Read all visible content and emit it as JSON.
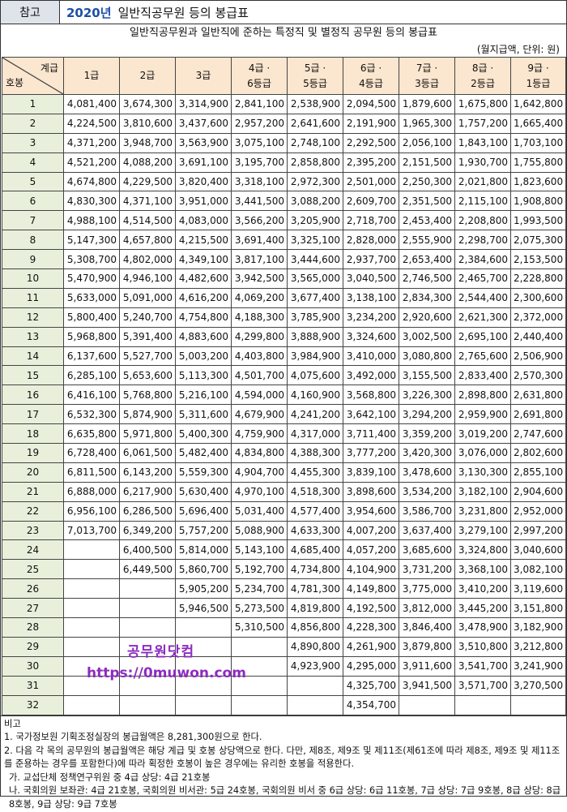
{
  "header": {
    "ref_label": "참고",
    "year": "2020년",
    "title": "일반직공무원 등의 봉급표"
  },
  "subtitle": "일반직공무원과 일반직에 준하는 특정직 및 별정직 공무원 등의 봉급표",
  "unit_note": "(월지급액, 단위: 원)",
  "table": {
    "corner_top": "계급",
    "corner_bottom": "호봉",
    "columns": [
      [
        "1급"
      ],
      [
        "2급"
      ],
      [
        "3급"
      ],
      [
        "4급 ·",
        "6등급"
      ],
      [
        "5급 ·",
        "5등급"
      ],
      [
        "6급 ·",
        "4등급"
      ],
      [
        "7급 ·",
        "3등급"
      ],
      [
        "8급 ·",
        "2등급"
      ],
      [
        "9급 ·",
        "1등급"
      ]
    ],
    "rows": [
      [
        "1",
        "4,081,400",
        "3,674,300",
        "3,314,900",
        "2,841,100",
        "2,538,900",
        "2,094,500",
        "1,879,600",
        "1,675,800",
        "1,642,800"
      ],
      [
        "2",
        "4,224,500",
        "3,810,600",
        "3,437,600",
        "2,957,200",
        "2,641,600",
        "2,191,900",
        "1,965,300",
        "1,757,200",
        "1,665,400"
      ],
      [
        "3",
        "4,371,200",
        "3,948,700",
        "3,563,900",
        "3,075,100",
        "2,748,100",
        "2,292,500",
        "2,056,100",
        "1,843,100",
        "1,703,100"
      ],
      [
        "4",
        "4,521,200",
        "4,088,200",
        "3,691,100",
        "3,195,700",
        "2,858,800",
        "2,395,200",
        "2,151,500",
        "1,930,700",
        "1,755,800"
      ],
      [
        "5",
        "4,674,800",
        "4,229,500",
        "3,820,400",
        "3,318,100",
        "2,972,300",
        "2,501,000",
        "2,250,300",
        "2,021,800",
        "1,823,600"
      ],
      [
        "6",
        "4,830,300",
        "4,371,100",
        "3,951,000",
        "3,441,500",
        "3,088,200",
        "2,609,700",
        "2,351,500",
        "2,115,100",
        "1,908,800"
      ],
      [
        "7",
        "4,988,100",
        "4,514,500",
        "4,083,000",
        "3,566,200",
        "3,205,900",
        "2,718,700",
        "2,453,400",
        "2,208,800",
        "1,993,500"
      ],
      [
        "8",
        "5,147,300",
        "4,657,800",
        "4,215,500",
        "3,691,400",
        "3,325,100",
        "2,828,000",
        "2,555,900",
        "2,298,700",
        "2,075,300"
      ],
      [
        "9",
        "5,308,700",
        "4,802,000",
        "4,349,100",
        "3,817,100",
        "3,444,600",
        "2,937,700",
        "2,653,400",
        "2,384,600",
        "2,153,500"
      ],
      [
        "10",
        "5,470,900",
        "4,946,100",
        "4,482,600",
        "3,942,500",
        "3,565,000",
        "3,040,500",
        "2,746,500",
        "2,465,700",
        "2,228,800"
      ],
      [
        "11",
        "5,633,000",
        "5,091,000",
        "4,616,200",
        "4,069,200",
        "3,677,400",
        "3,138,100",
        "2,834,300",
        "2,544,400",
        "2,300,600"
      ],
      [
        "12",
        "5,800,400",
        "5,240,700",
        "4,754,800",
        "4,188,300",
        "3,785,900",
        "3,234,200",
        "2,920,600",
        "2,621,300",
        "2,372,000"
      ],
      [
        "13",
        "5,968,800",
        "5,391,400",
        "4,883,600",
        "4,299,800",
        "3,888,900",
        "3,324,600",
        "3,002,500",
        "2,695,100",
        "2,440,400"
      ],
      [
        "14",
        "6,137,600",
        "5,527,700",
        "5,003,200",
        "4,403,800",
        "3,984,900",
        "3,410,000",
        "3,080,800",
        "2,765,600",
        "2,506,900"
      ],
      [
        "15",
        "6,285,100",
        "5,653,600",
        "5,113,300",
        "4,501,700",
        "4,075,600",
        "3,492,000",
        "3,155,500",
        "2,833,400",
        "2,570,300"
      ],
      [
        "16",
        "6,416,100",
        "5,768,800",
        "5,216,100",
        "4,594,000",
        "4,160,900",
        "3,568,800",
        "3,226,300",
        "2,898,800",
        "2,631,800"
      ],
      [
        "17",
        "6,532,300",
        "5,874,900",
        "5,311,600",
        "4,679,900",
        "4,241,200",
        "3,642,100",
        "3,294,200",
        "2,959,900",
        "2,691,800"
      ],
      [
        "18",
        "6,635,800",
        "5,971,800",
        "5,400,300",
        "4,759,900",
        "4,317,000",
        "3,711,400",
        "3,359,200",
        "3,019,200",
        "2,747,600"
      ],
      [
        "19",
        "6,728,400",
        "6,061,500",
        "5,482,400",
        "4,834,800",
        "4,388,300",
        "3,777,200",
        "3,420,300",
        "3,076,000",
        "2,802,600"
      ],
      [
        "20",
        "6,811,500",
        "6,143,200",
        "5,559,300",
        "4,904,700",
        "4,455,300",
        "3,839,100",
        "3,478,600",
        "3,130,300",
        "2,855,100"
      ],
      [
        "21",
        "6,888,000",
        "6,217,900",
        "5,630,400",
        "4,970,100",
        "4,518,300",
        "3,898,600",
        "3,534,200",
        "3,182,100",
        "2,904,600"
      ],
      [
        "22",
        "6,956,100",
        "6,286,500",
        "5,696,400",
        "5,031,400",
        "4,577,400",
        "3,954,600",
        "3,586,700",
        "3,231,800",
        "2,952,000"
      ],
      [
        "23",
        "7,013,700",
        "6,349,200",
        "5,757,200",
        "5,088,900",
        "4,633,300",
        "4,007,200",
        "3,637,400",
        "3,279,100",
        "2,997,200"
      ],
      [
        "24",
        "",
        "6,400,500",
        "5,814,000",
        "5,143,100",
        "4,685,400",
        "4,057,200",
        "3,685,600",
        "3,324,800",
        "3,040,600"
      ],
      [
        "25",
        "",
        "6,449,500",
        "5,860,700",
        "5,192,700",
        "4,734,800",
        "4,104,900",
        "3,731,200",
        "3,368,100",
        "3,082,100"
      ],
      [
        "26",
        "",
        "",
        "5,905,200",
        "5,234,700",
        "4,781,300",
        "4,149,800",
        "3,775,000",
        "3,410,200",
        "3,119,600"
      ],
      [
        "27",
        "",
        "",
        "5,946,500",
        "5,273,500",
        "4,819,800",
        "4,192,500",
        "3,812,000",
        "3,445,200",
        "3,151,800"
      ],
      [
        "28",
        "",
        "",
        "",
        "5,310,500",
        "4,856,800",
        "4,228,300",
        "3,846,400",
        "3,478,900",
        "3,182,900"
      ],
      [
        "29",
        "",
        "",
        "",
        "",
        "4,890,800",
        "4,261,900",
        "3,879,800",
        "3,510,800",
        "3,212,800"
      ],
      [
        "30",
        "",
        "",
        "",
        "",
        "4,923,900",
        "4,295,000",
        "3,911,600",
        "3,541,700",
        "3,241,900"
      ],
      [
        "31",
        "",
        "",
        "",
        "",
        "",
        "4,325,700",
        "3,941,500",
        "3,571,700",
        "3,270,500"
      ],
      [
        "32",
        "",
        "",
        "",
        "",
        "",
        "4,354,700",
        "",
        "",
        ""
      ]
    ]
  },
  "watermark": {
    "site": "공무원닷컴",
    "url": "https://0muwon.com"
  },
  "remarks": {
    "heading": "비고",
    "items": [
      "1. 국가정보원 기획조정실장의 봉급월액은 8,281,300원으로 한다.",
      "2. 다음 각 목의 공무원의 봉급월액은 해당 계급 및 호봉 상당액으로 한다. 다만, 제8조, 제9조 및 제11조(제61조에 따라 제8조, 제9조 및 제11조를 준용하는 경우를 포함한다)에 따라 획정한 호봉이 높은 경우에는 유리한 호봉을 적용한다.",
      "가. 교섭단체 정책연구위원 중 4급 상당: 4급 21호봉",
      "나. 국회의원 보좌관: 4급 21호봉, 국회의원 비서관: 5급 24호봉, 국회의원 비서 중 6급 상당: 6급 11호봉, 7급 상당: 7급 9호봉, 8급 상당: 8급 8호봉, 9급 상당: 9급 7호봉"
    ]
  }
}
